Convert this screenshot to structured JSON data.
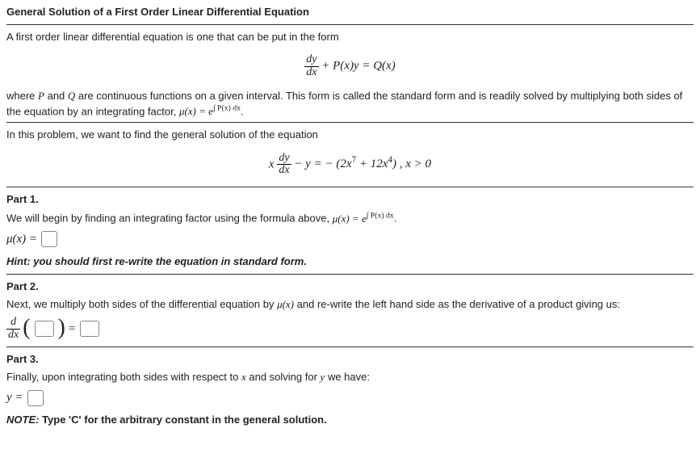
{
  "title": "General Solution of a First Order Linear Differential Equation",
  "intro_line": "A first order linear differential equation is one that can be put in the form",
  "eq_general_lhs_num": "dy",
  "eq_general_lhs_den": "dx",
  "eq_general_rest": " + P(x)y = Q(x)",
  "explain_before": "where ",
  "explain_P": "P",
  "explain_mid1": " and ",
  "explain_Q": "Q",
  "explain_after1": " are continuous functions on a given interval. This form is called the standard form and is readily solved by multiplying both sides of the equation by an integrating factor, ",
  "mu_expr": "μ(x) = e",
  "mu_exp": "∫ P(x) dx",
  "explain_period": ".",
  "problem_line": "In this problem, we want to find the general solution of the equation",
  "eq_problem_x": "x",
  "eq_problem_num": "dy",
  "eq_problem_den": "dx",
  "eq_problem_rest_a": " − y = − (2x",
  "eq_problem_exp1": "7",
  "eq_problem_rest_b": " + 12x",
  "eq_problem_exp2": "4",
  "eq_problem_rest_c": ") , x > 0",
  "part1_head": "Part 1.",
  "part1_line_a": "We will begin by finding an integrating factor using the formula above, ",
  "part1_mu": "μ(x) = e",
  "part1_mu_exp": "∫ P(x) dx",
  "part1_period": ".",
  "part1_mu_lhs": "μ(x) = ",
  "part1_hint": "Hint: you should first re-write the equation in standard form.",
  "part2_head": "Part 2.",
  "part2_line_a": "Next, we multiply both sides of the differential equation by ",
  "part2_mu": "μ(x)",
  "part2_line_b": " and re-write the left hand side as the derivative of a product giving us:",
  "part2_frac_num": "d",
  "part2_frac_den": "dx",
  "part2_eq": " = ",
  "part3_head": "Part 3.",
  "part3_line_a": "Finally, upon integrating both sides with respect to ",
  "part3_x": "x",
  "part3_line_b": " and solving for ",
  "part3_y": "y",
  "part3_line_c": " we have:",
  "part3_ylhs": "y = ",
  "note_label": "NOTE:",
  "note_text": " Type 'C' for the arbitrary constant in the general solution."
}
